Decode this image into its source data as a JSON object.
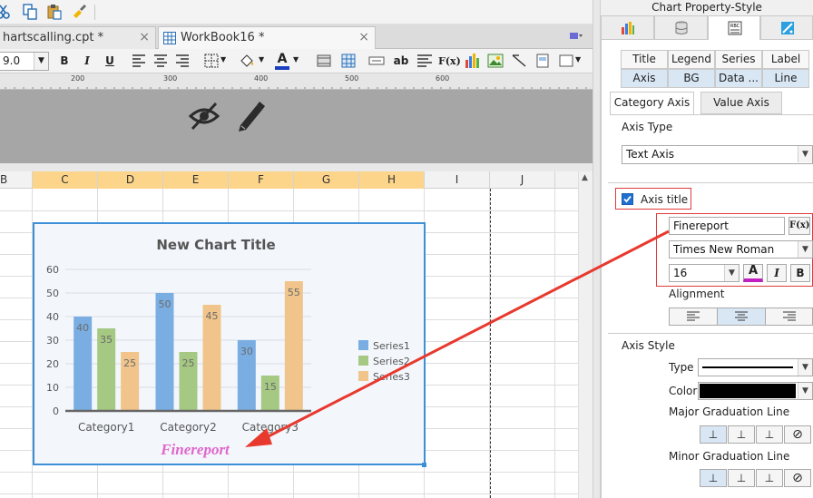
{
  "toolbar": {
    "icons": [
      "cut-icon",
      "copy-icon",
      "paste-icon",
      "format-painter-icon"
    ]
  },
  "tabs": [
    {
      "label": "hartscalling.cpt *",
      "close": "×"
    },
    {
      "label": "WorkBook16 *",
      "close": "×"
    }
  ],
  "format_toolbar": {
    "font_size": "9.0",
    "bold": "B",
    "italic": "I",
    "underline": "U",
    "text_label": "ab",
    "formula_label": "F(x)"
  },
  "ruler": {
    "marks": [
      "200",
      "300",
      "400",
      "500",
      "600"
    ]
  },
  "columns": [
    "B",
    "C",
    "D",
    "E",
    "F",
    "G",
    "H",
    "I",
    "J"
  ],
  "selected_columns": [
    "C",
    "D",
    "E",
    "F",
    "G",
    "H"
  ],
  "chart_data": {
    "type": "bar",
    "title": "New Chart Title",
    "categories": [
      "Category1",
      "Category2",
      "Category3"
    ],
    "series": [
      {
        "name": "Series1",
        "values": [
          40,
          50,
          30
        ],
        "color": "#7aaee3"
      },
      {
        "name": "Series2",
        "values": [
          35,
          25,
          15
        ],
        "color": "#a5c882"
      },
      {
        "name": "Series3",
        "values": [
          25,
          45,
          55
        ],
        "color": "#f0c48a"
      }
    ],
    "ylim": [
      0,
      60
    ],
    "yticks": [
      "0",
      "10",
      "20",
      "30",
      "40",
      "50",
      "60"
    ],
    "axis_title": "Finereport",
    "axis_title_color": "#e066cc",
    "legend_position": "right",
    "data_labels": true
  },
  "panel": {
    "title": "Chart Property-Style",
    "top_tabs": [
      "chart-type-icon",
      "data-icon",
      "style-icon",
      "effect-icon"
    ],
    "style_tabs_row1": [
      "Title",
      "Legend",
      "Series",
      "Label"
    ],
    "style_tabs_row2": [
      "Axis",
      "BG",
      "Data ...",
      "Line"
    ],
    "sub_tabs": [
      "Category Axis",
      "Value Axis"
    ],
    "axis_type_label": "Axis Type",
    "axis_type_value": "Text Axis",
    "axis_title_checkbox": "Axis title",
    "axis_title_text": "Finereport",
    "formula_button": "F(x)",
    "font_family": "Times New Roman",
    "font_size": "16",
    "font_color_button": "A",
    "italic_button": "I",
    "bold_button": "B",
    "alignment_label": "Alignment",
    "axis_style_label": "Axis Style",
    "type_label": "Type",
    "color_label": "Color",
    "color_value": "#000000",
    "major_grad_label": "Major Graduation Line",
    "minor_grad_label": "Minor Graduation Line"
  }
}
